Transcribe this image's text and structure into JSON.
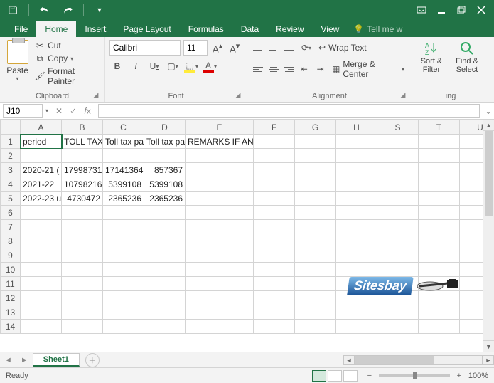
{
  "tabs": {
    "file": "File",
    "home": "Home",
    "insert": "Insert",
    "pagelayout": "Page Layout",
    "formulas": "Formulas",
    "data": "Data",
    "review": "Review",
    "view": "View",
    "tellme": "Tell me w"
  },
  "clipboard": {
    "paste": "Paste",
    "cut": "Cut",
    "copy": "Copy",
    "fmtpainter": "Format Painter",
    "label": "Clipboard"
  },
  "font": {
    "name": "Calibri",
    "size": "11",
    "label": "Font"
  },
  "alignment": {
    "wrap": "Wrap Text",
    "merge": "Merge & Center",
    "label": "Alignment"
  },
  "editing": {
    "sort": "Sort & Filter",
    "find": "Find & Select",
    "label": "ing"
  },
  "namebox": "J10",
  "formula": "",
  "columns": [
    "A",
    "B",
    "C",
    "D",
    "E",
    "F",
    "G",
    "H",
    "S",
    "T",
    "U"
  ],
  "headers": {
    "A": "period",
    "B": "TOLL TAX",
    "C": "Toll tax pa",
    "D": "Toll tax pa",
    "E": "REMARKS IF ANY"
  },
  "rows": [
    {
      "A": "2020-21 (",
      "B": "17998731",
      "C": "17141364",
      "D": "857367"
    },
    {
      "A": "2021-22",
      "B": "10798216",
      "C": "5399108",
      "D": "5399108"
    },
    {
      "A": "2022-23 u",
      "B": "4730472",
      "C": "2365236",
      "D": "2365236"
    }
  ],
  "sheet": {
    "name": "Sheet1"
  },
  "status": {
    "ready": "Ready",
    "zoom": "100%"
  },
  "watermark": "Sitesbay"
}
